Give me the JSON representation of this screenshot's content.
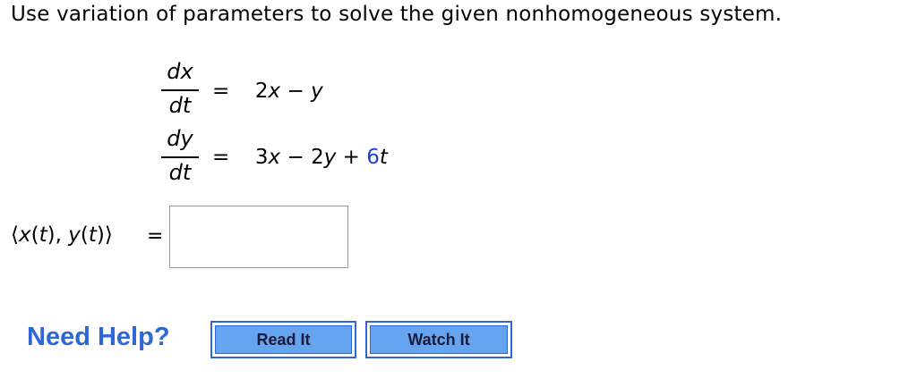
{
  "prompt": "Use variation of parameters to solve the given nonhomogeneous system.",
  "equations": [
    {
      "numerator": "dx",
      "denominator": "dt",
      "equals": "=",
      "rhs": {
        "t1": "2",
        "t2": "x",
        "t3": " − ",
        "t4": "y"
      }
    },
    {
      "numerator": "dy",
      "denominator": "dt",
      "equals": "=",
      "rhs": {
        "t1": "3",
        "t2": "x",
        "t3": " − ",
        "t4": "2",
        "t5": "y",
        "t6": " + ",
        "t7": "6",
        "t8": "t"
      }
    }
  ],
  "answer": {
    "tuple": {
      "open": "⟨",
      "x": "x",
      "lp1": "(",
      "t1": "t",
      "rp1": ")",
      "comma": ", ",
      "y": "y",
      "lp2": "(",
      "t2": "t",
      "rp2": ")",
      "close": "⟩"
    },
    "equals": "=",
    "value": ""
  },
  "help": {
    "title": "Need Help?",
    "read_label": "Read It",
    "watch_label": "Watch It"
  },
  "colors": {
    "accent": "#2f66d8",
    "button_fill": "#66a4ef",
    "highlight": "#1a3fd4"
  }
}
